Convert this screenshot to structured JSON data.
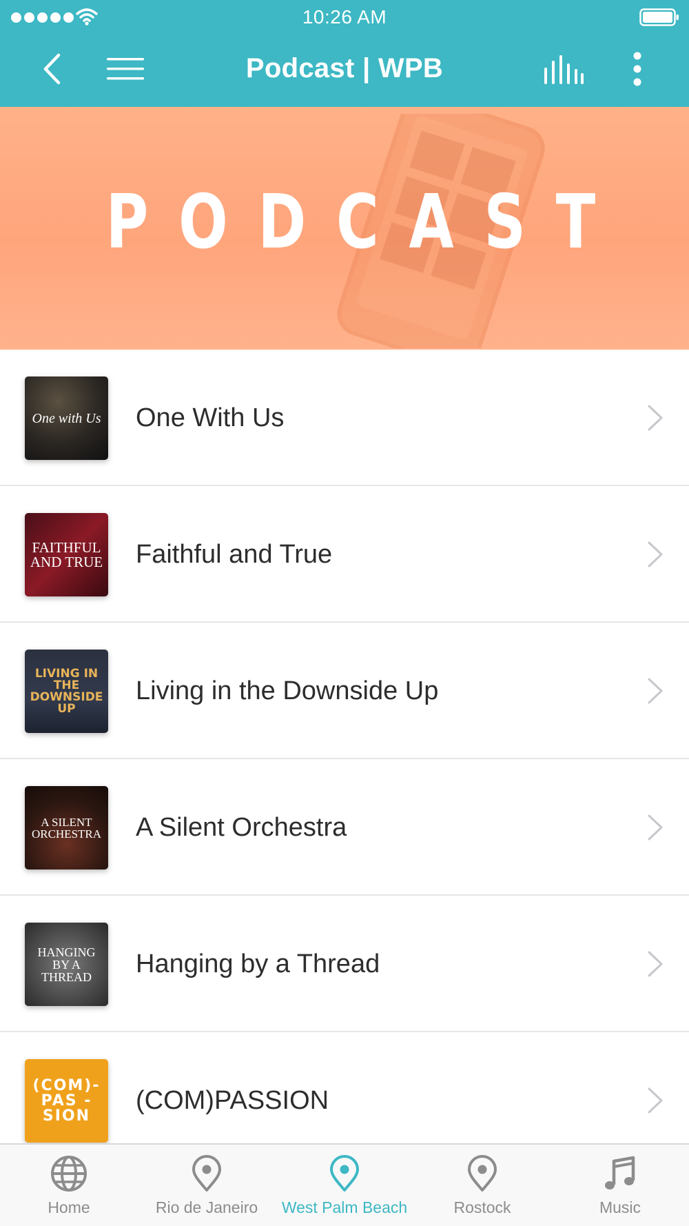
{
  "status_bar": {
    "time": "10:26 AM"
  },
  "nav": {
    "title": "Podcast | WPB"
  },
  "banner": {
    "word": "PODCAST"
  },
  "podcasts": [
    {
      "title": "One With Us",
      "art_text": "One with Us"
    },
    {
      "title": "Faithful and True",
      "art_text": "FAITHFUL and TRUE"
    },
    {
      "title": "Living in the Downside Up",
      "art_text": "LIVING IN THE DOWNSIDE UP"
    },
    {
      "title": "A Silent Orchestra",
      "art_text": "A SILENT ORCHESTRA"
    },
    {
      "title": "Hanging by a Thread",
      "art_text": "HANGING BY A THREAD"
    },
    {
      "title": "(COM)PASSION",
      "art_text": "(COM)- PAS -SION"
    }
  ],
  "tabs": [
    {
      "label": "Home",
      "icon": "globe-icon"
    },
    {
      "label": "Rio de Janeiro",
      "icon": "location-pin-icon"
    },
    {
      "label": "West Palm Beach",
      "icon": "location-pin-icon",
      "active": true
    },
    {
      "label": "Rostock",
      "icon": "location-pin-icon"
    },
    {
      "label": "Music",
      "icon": "music-note-icon"
    }
  ],
  "colors": {
    "accent": "#3db8c4",
    "banner": "#ffa97f",
    "tab_inactive": "#8c8c8c"
  }
}
